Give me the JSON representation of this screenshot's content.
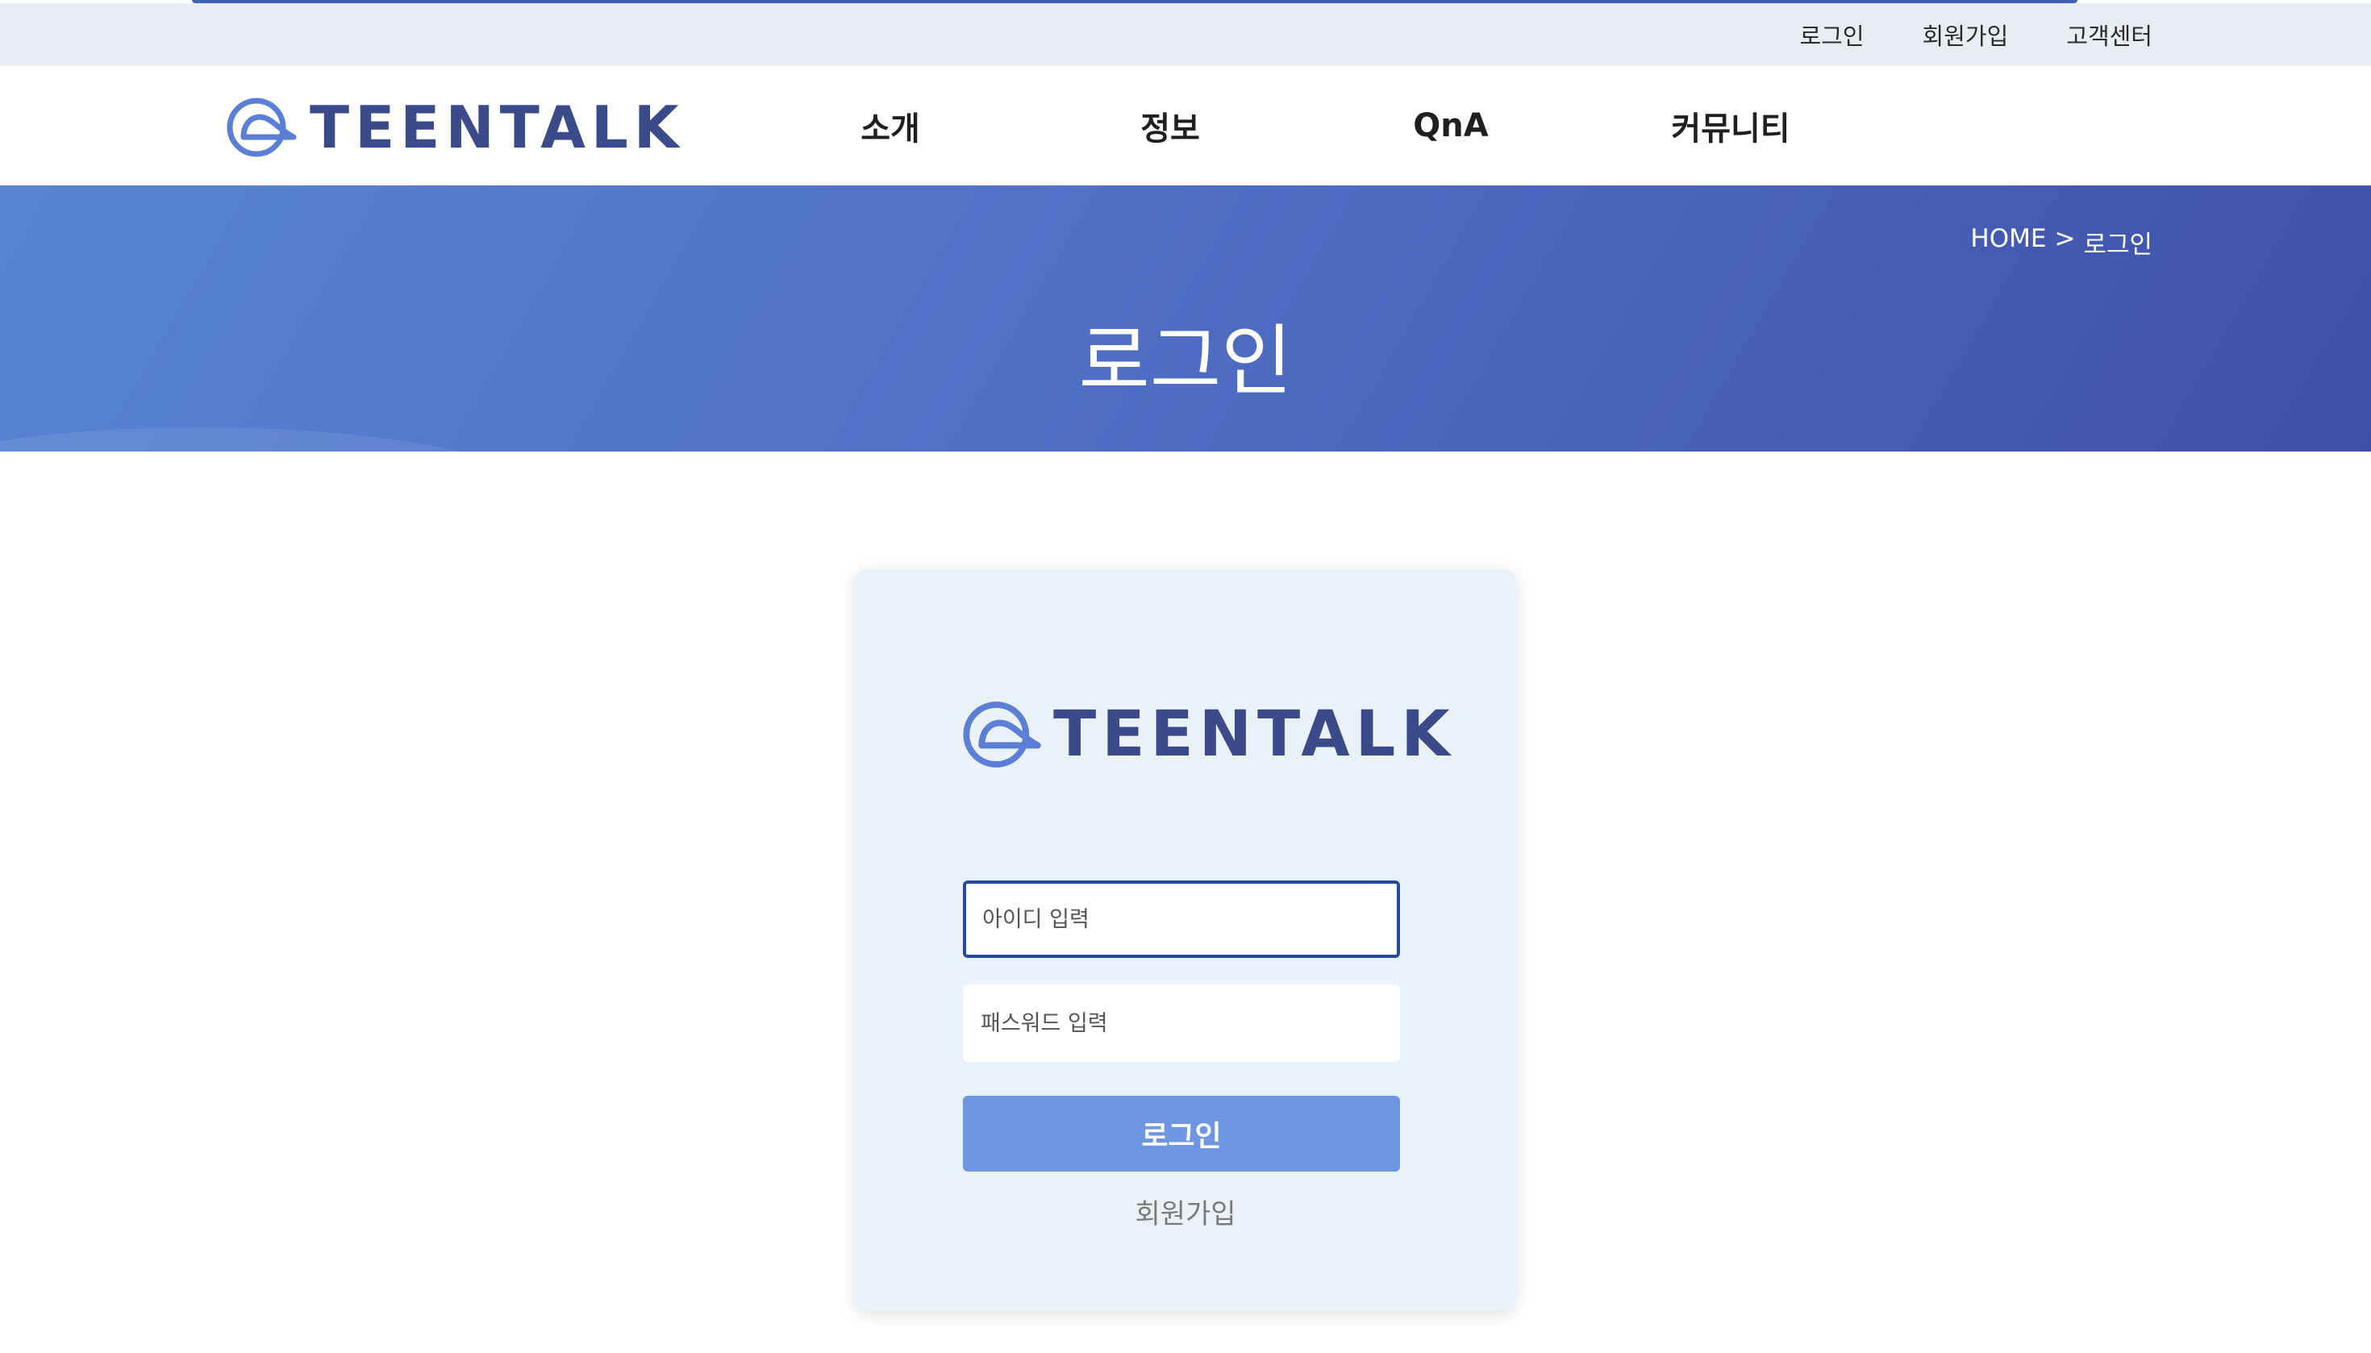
{
  "util_bar": {
    "links": [
      "로그인",
      "회원가입",
      "고객센터"
    ]
  },
  "brand": {
    "name": "TEENTALK",
    "colors": {
      "primary": "#3b4a8a",
      "accent": "#5b7fd6",
      "banner_start": "#5784d2",
      "banner_end": "#3e4fa9",
      "button": "#7096e3"
    }
  },
  "nav": {
    "items": [
      "소개",
      "정보",
      "QnA",
      "커뮤니티"
    ]
  },
  "banner": {
    "breadcrumb_home": "HOME",
    "breadcrumb_sep": ">",
    "breadcrumb_current": "로그인",
    "title": "로그인"
  },
  "login_form": {
    "id_placeholder": "아이디 입력",
    "password_placeholder": "패스워드 입력",
    "submit_label": "로그인",
    "signup_label": "회원가입"
  }
}
